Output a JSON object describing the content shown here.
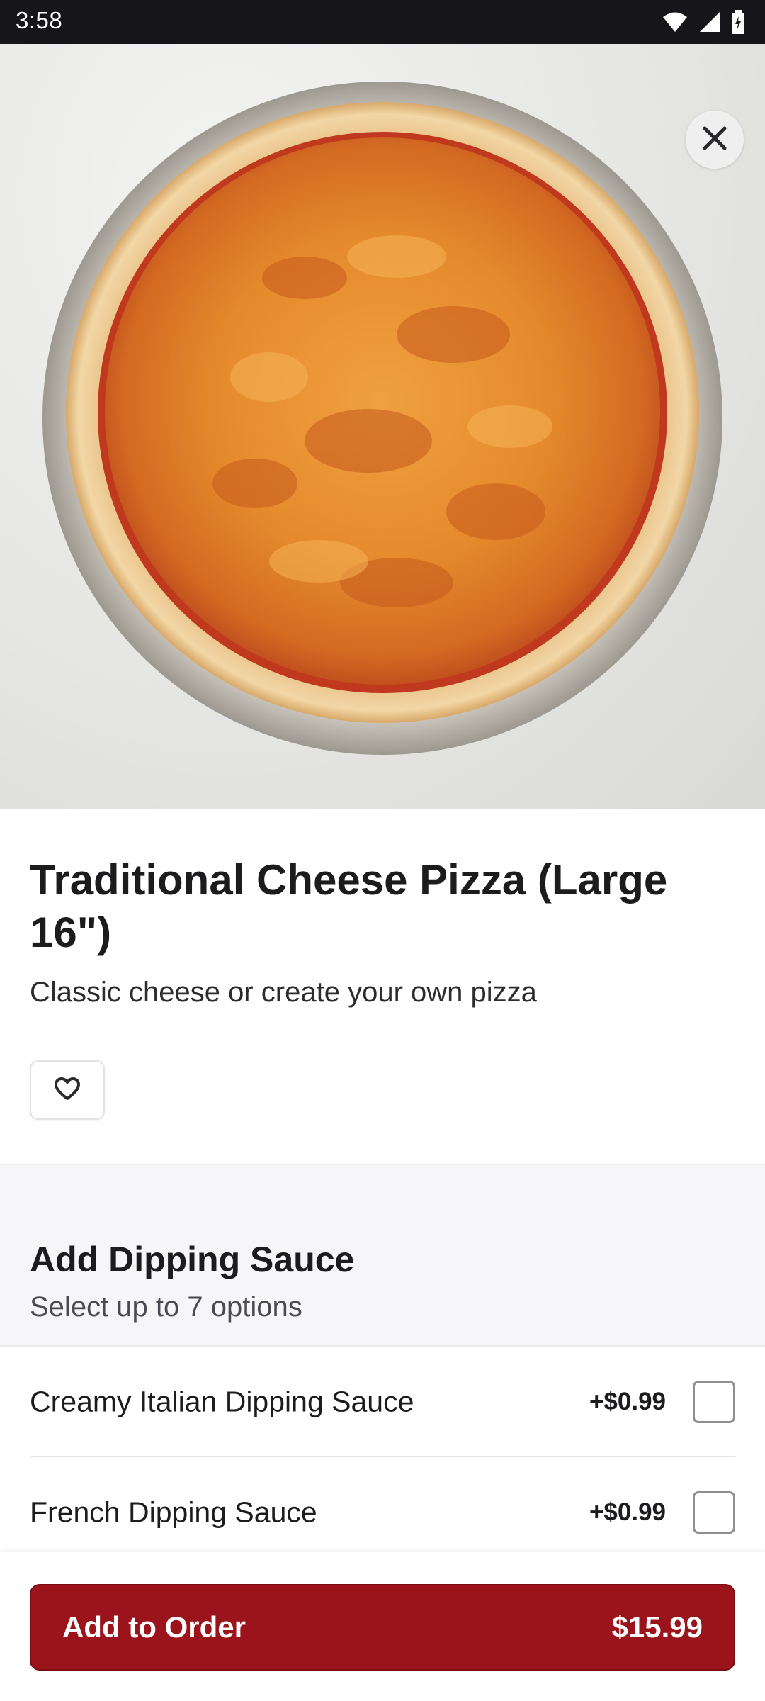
{
  "status_bar": {
    "time": "3:58"
  },
  "item": {
    "title": "Traditional Cheese Pizza (Large 16\")",
    "description": "Classic cheese or create your own pizza"
  },
  "modifier_group": {
    "title": "Add Dipping Sauce",
    "subtitle": "Select up to 7 options",
    "options": [
      {
        "label": "Creamy Italian Dipping Sauce",
        "price": "+$0.99",
        "checked": false
      },
      {
        "label": "French Dipping Sauce",
        "price": "+$0.99",
        "checked": false
      }
    ]
  },
  "footer": {
    "button_label": "Add to Order",
    "total": "$15.99"
  },
  "colors": {
    "primary": "#9b141b",
    "status_bar": "#15151a",
    "section_bg": "#f6f6f8"
  },
  "icons": [
    "wifi-icon",
    "cellular-signal-icon",
    "battery-icon",
    "close-icon",
    "heart-icon"
  ]
}
